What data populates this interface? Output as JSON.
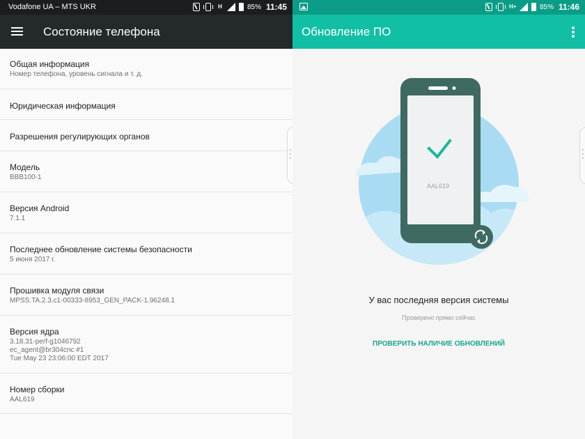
{
  "left_screen": {
    "status_bar": {
      "carrier": "Vodafone UA – MTS UKR",
      "network_type": "H",
      "battery": "85%",
      "time": "11:45"
    },
    "app_bar": {
      "title": "Состояние телефона"
    },
    "items": [
      {
        "title": "Общая информация",
        "subtitle": "Номер телефона, уровень сигнала и т. д."
      },
      {
        "title": "Юридическая информация",
        "subtitle": ""
      },
      {
        "title": "Разрешения регулирующих органов",
        "subtitle": ""
      },
      {
        "title": "Модель",
        "subtitle": "BBB100-1"
      },
      {
        "title": "Версия Android",
        "subtitle": "7.1.1"
      },
      {
        "title": "Последнее обновление системы безопасности",
        "subtitle": "5 июня 2017 г."
      },
      {
        "title": "Прошивка модуля связи",
        "subtitle": "MPSS.TA.2.3.c1-00333-8953_GEN_PACK-1.96248.1"
      },
      {
        "title": "Версия ядра",
        "subtitle": "3.18.31-perf-g1046792\nec_agent@br304cnc #1\nTue May 23 23:06:00 EDT 2017"
      },
      {
        "title": "Номер сборки",
        "subtitle": "AAL619"
      }
    ]
  },
  "right_screen": {
    "status_bar": {
      "network_type": "H+",
      "battery": "85%",
      "time": "11:46"
    },
    "app_bar": {
      "title": "Обновление ПО"
    },
    "phone_screen_label": "AAL619",
    "message": "У вас последняя версия системы",
    "checked_text": "Проверено прямо сейчас",
    "check_button": "ПРОВЕРИТЬ НАЛИЧИЕ ОБНОВЛЕНИЙ"
  },
  "colors": {
    "left_app_bar": "#24292c",
    "left_status_bar": "#1b1e20",
    "right_app_bar": "#11bfa4",
    "right_status_bar": "#0a9c87",
    "accent": "#17a58e",
    "phone_body": "#3e6a62"
  }
}
